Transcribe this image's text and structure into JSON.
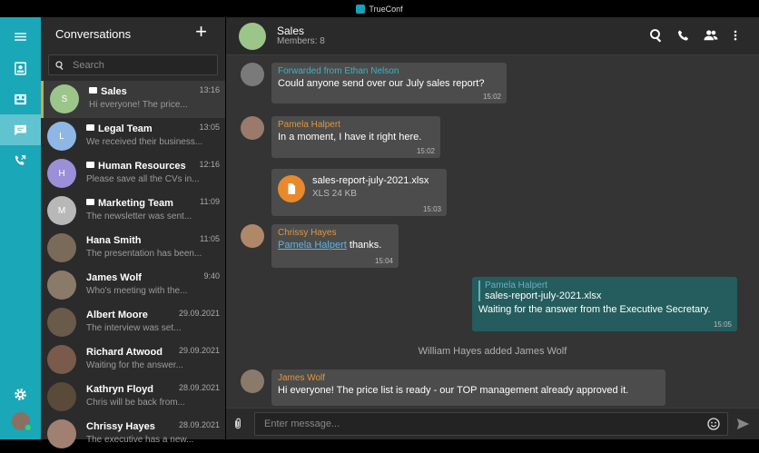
{
  "app": {
    "title": "TrueConf"
  },
  "conversations": {
    "header": "Conversations",
    "search_placeholder": "Search",
    "items": [
      {
        "name": "Sales",
        "preview": "Hi everyone! The price...",
        "time": "13:16",
        "initial": "S",
        "group": true,
        "color": "#9cc58a"
      },
      {
        "name": "Legal Team",
        "preview": "We received their business...",
        "time": "13:05",
        "initial": "L",
        "group": true,
        "color": "#8fb7e6"
      },
      {
        "name": "Human Resources",
        "preview": "Please save all the CVs in...",
        "time": "12:16",
        "initial": "H",
        "group": true,
        "color": "#9a8fd8"
      },
      {
        "name": "Marketing Team",
        "preview": "The newsletter was sent...",
        "time": "11:09",
        "initial": "M",
        "group": true,
        "color": "#b8b8b8"
      },
      {
        "name": "Hana Smith",
        "preview": "The presentation has been...",
        "time": "11:05",
        "initial": "",
        "group": false,
        "color": "#7a6a5a"
      },
      {
        "name": "James Wolf",
        "preview": "Who's meeting with the...",
        "time": "9:40",
        "initial": "",
        "group": false,
        "color": "#8a7a6a"
      },
      {
        "name": "Albert Moore",
        "preview": "The interview was set...",
        "time": "29.09.2021",
        "initial": "",
        "group": false,
        "color": "#6a5a4a"
      },
      {
        "name": "Richard Atwood",
        "preview": "Waiting for the answer...",
        "time": "29.09.2021",
        "initial": "",
        "group": false,
        "color": "#7a5a4a"
      },
      {
        "name": "Kathryn Floyd",
        "preview": "Chris will be back from...",
        "time": "28.09.2021",
        "initial": "",
        "group": false,
        "color": "#5a4a3a"
      },
      {
        "name": "Chrissy Hayes",
        "preview": "The executive has a new...",
        "time": "28.09.2021",
        "initial": "",
        "group": false,
        "color": "#a08070"
      }
    ]
  },
  "chat": {
    "title": "Sales",
    "members": "Members: 8",
    "messages": {
      "m1": {
        "forwarded": "Forwarded from Ethan Nelson",
        "text": "Could anyone send over our July sales report?",
        "time": "15:02"
      },
      "m2": {
        "author": "Pamela Halpert",
        "text": "In a moment, I have it right here.",
        "time": "15:02"
      },
      "m3": {
        "filename": "sales-report-july-2021.xlsx",
        "filesize": "XLS 24 KB",
        "time": "15:03"
      },
      "m4": {
        "author": "Chrissy Hayes",
        "mention": "Pamela Halpert",
        "text": " thanks.",
        "time": "15:04"
      },
      "m5": {
        "quote_author": "Pamela Halpert",
        "quote_text": "sales-report-july-2021.xlsx",
        "text": "Waiting for the answer from the Executive Secretary.",
        "time": "15:05"
      },
      "system": "William Hayes added James Wolf",
      "m6": {
        "author": "James Wolf",
        "text": "Hi everyone! The price list is ready - our TOP management already approved it."
      }
    },
    "composer_placeholder": "Enter message..."
  },
  "colors": {
    "rail": "#1aa7b8",
    "accent": "#e0963a",
    "own_bubble": "#255d5e"
  }
}
